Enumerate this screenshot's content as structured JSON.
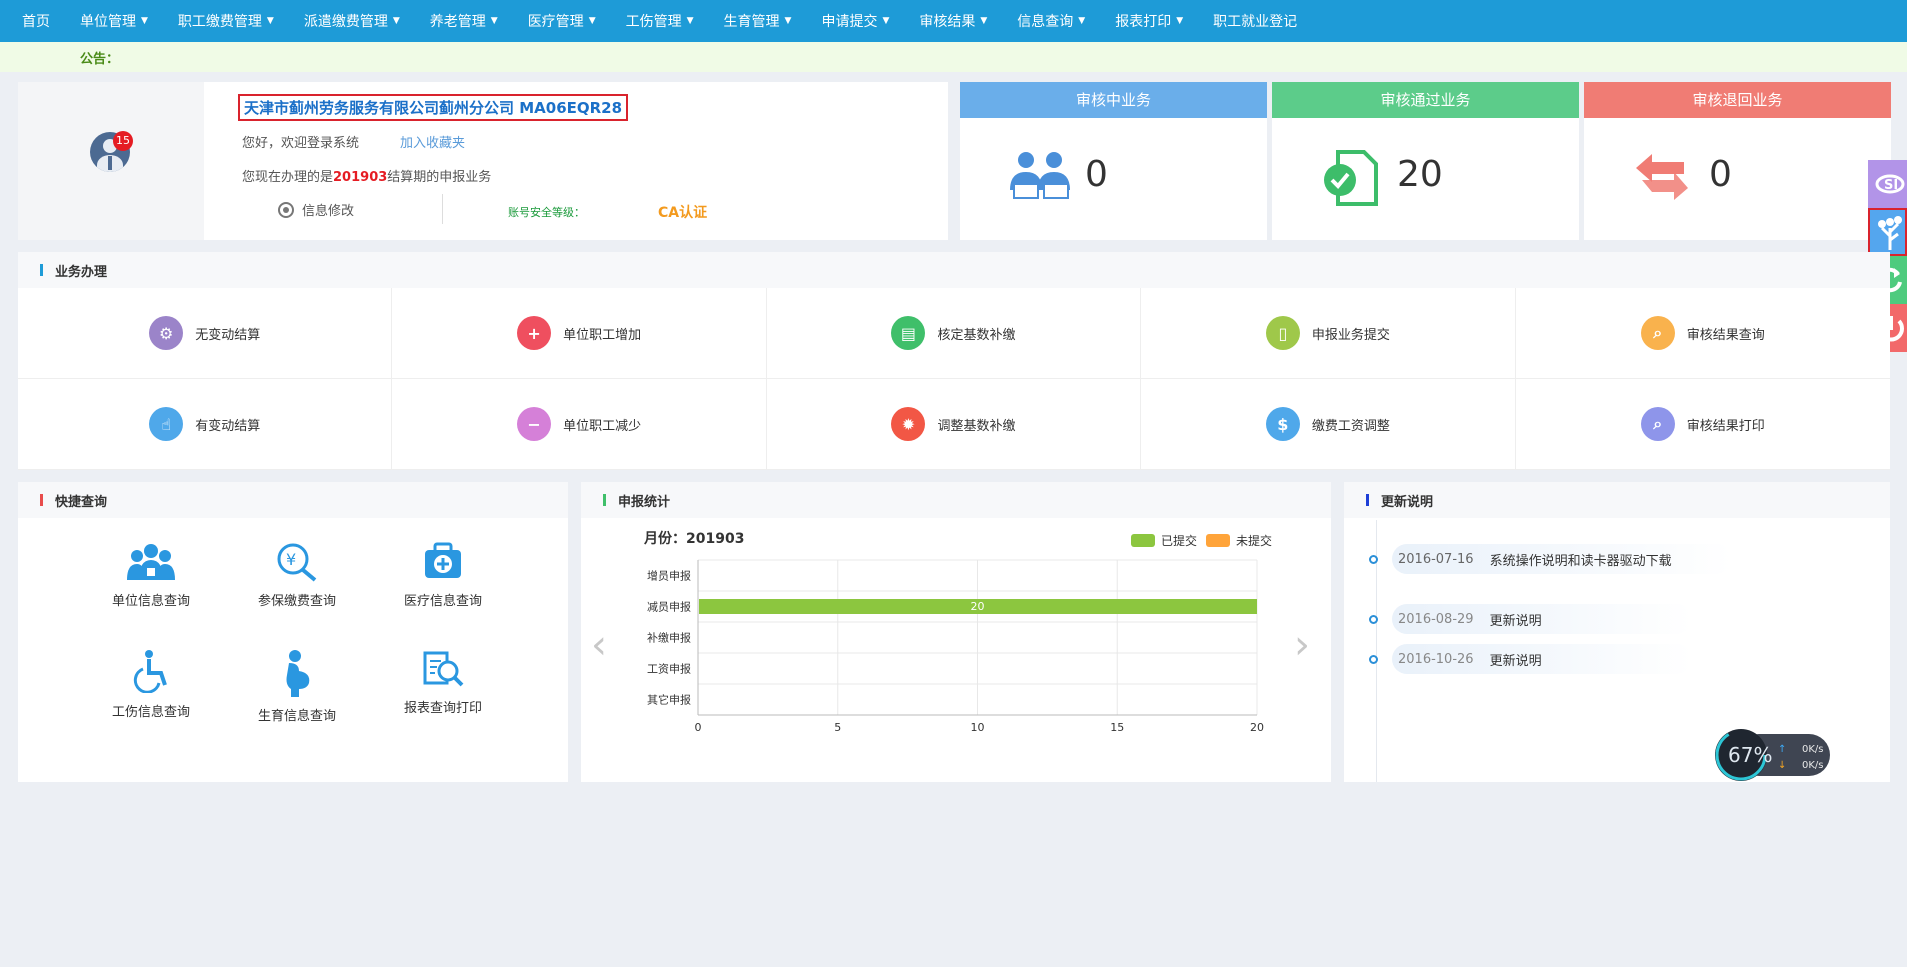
{
  "nav": {
    "items": [
      {
        "label": "首页",
        "has_menu": false
      },
      {
        "label": "单位管理",
        "has_menu": true
      },
      {
        "label": "职工缴费管理",
        "has_menu": true
      },
      {
        "label": "派遣缴费管理",
        "has_menu": true
      },
      {
        "label": "养老管理",
        "has_menu": true
      },
      {
        "label": "医疗管理",
        "has_menu": true
      },
      {
        "label": "工伤管理",
        "has_menu": true
      },
      {
        "label": "生育管理",
        "has_menu": true
      },
      {
        "label": "申请提交",
        "has_menu": true
      },
      {
        "label": "审核结果",
        "has_menu": true
      },
      {
        "label": "信息查询",
        "has_menu": true
      },
      {
        "label": "报表打印",
        "has_menu": true
      },
      {
        "label": "职工就业登记",
        "has_menu": false
      }
    ],
    "caret": "▼"
  },
  "notice": {
    "label": "公告："
  },
  "user": {
    "badge": "15",
    "company": "天津市蓟州劳务服务有限公司蓟州分公司 MA06EQR28",
    "greeting": "您好，欢迎登录系统",
    "favorite": "加入收藏夹",
    "period_prefix": "您现在办理的是",
    "period": "201903",
    "period_suffix": "结算期的申报业务",
    "edit_info": "信息修改",
    "security_level": "账号安全等级：",
    "ca": "CA认证"
  },
  "stats_cards": [
    {
      "title": "审核中业务",
      "value": "0",
      "color": "#6aaeea"
    },
    {
      "title": "审核通过业务",
      "value": "20",
      "color": "#5ccc8a"
    },
    {
      "title": "审核退回业务",
      "value": "0",
      "color": "#f07c74"
    }
  ],
  "business": {
    "title": "业务办理",
    "items": [
      {
        "label": "无变动结算",
        "color": "#9b84c9",
        "icon": "user-settle-icon"
      },
      {
        "label": "单位职工增加",
        "color": "#ef4f5f",
        "icon": "user-add-icon"
      },
      {
        "label": "核定基数补缴",
        "color": "#3fbf6a",
        "icon": "card-icon"
      },
      {
        "label": "申报业务提交",
        "color": "#9fc84a",
        "icon": "document-icon"
      },
      {
        "label": "审核结果查询",
        "color": "#f9b24d",
        "icon": "search-icon"
      },
      {
        "label": "有变动结算",
        "color": "#4fa8ea",
        "icon": "hand-icon"
      },
      {
        "label": "单位职工减少",
        "color": "#d580d8",
        "icon": "user-remove-icon"
      },
      {
        "label": "调整基数补缴",
        "color": "#f25745",
        "icon": "gear-icon"
      },
      {
        "label": "缴费工资调整",
        "color": "#4fa8ea",
        "icon": "money-icon"
      },
      {
        "label": "审核结果打印",
        "color": "#8e95ea",
        "icon": "print-search-icon"
      }
    ]
  },
  "quick": {
    "title": "快捷查询",
    "items": [
      {
        "label": "单位信息查询",
        "icon": "group-icon"
      },
      {
        "label": "参保缴费查询",
        "icon": "yen-search-icon"
      },
      {
        "label": "医疗信息查询",
        "icon": "medical-kit-icon"
      },
      {
        "label": "工伤信息查询",
        "icon": "wheelchair-icon"
      },
      {
        "label": "生育信息查询",
        "icon": "pregnant-icon"
      },
      {
        "label": "报表查询打印",
        "icon": "report-search-icon"
      }
    ]
  },
  "report_stats": {
    "title": "申报统计",
    "month_label": "月份：201903",
    "prev_arrow": "‹",
    "next_arrow": "›"
  },
  "chart_data": {
    "type": "bar",
    "orientation": "horizontal",
    "categories": [
      "增员申报",
      "减员申报",
      "补缴申报",
      "工资申报",
      "其它申报"
    ],
    "series": [
      {
        "name": "已提交",
        "values": [
          0,
          20,
          0,
          0,
          0
        ],
        "color": "#8cc63f"
      },
      {
        "name": "未提交",
        "values": [
          0,
          0,
          0,
          0,
          0
        ],
        "color": "#ffa43a"
      }
    ],
    "xlim": [
      0,
      20
    ],
    "xticks": [
      0,
      5,
      10,
      15,
      20
    ],
    "data_labels": [
      "20"
    ],
    "grid": true,
    "legend_position": "top-right"
  },
  "updates": {
    "title": "更新说明",
    "items": [
      {
        "date": "2016-07-16",
        "text": "系统操作说明和读卡器驱动下载"
      },
      {
        "date": "2016-08-29",
        "text": "更新说明"
      },
      {
        "date": "2016-10-26",
        "text": "更新说明"
      }
    ]
  },
  "speed_widget": {
    "percent": "67",
    "unit": "%",
    "upload": "0K/s",
    "download": "0K/s"
  },
  "side_buttons": [
    {
      "icon": "logo-icon",
      "color": "#b294e8"
    },
    {
      "icon": "tree-icon",
      "color": "#54a6ee"
    },
    {
      "icon": "refresh-icon",
      "color": "#4ecb7e"
    },
    {
      "icon": "power-icon",
      "color": "#f2696a"
    }
  ]
}
